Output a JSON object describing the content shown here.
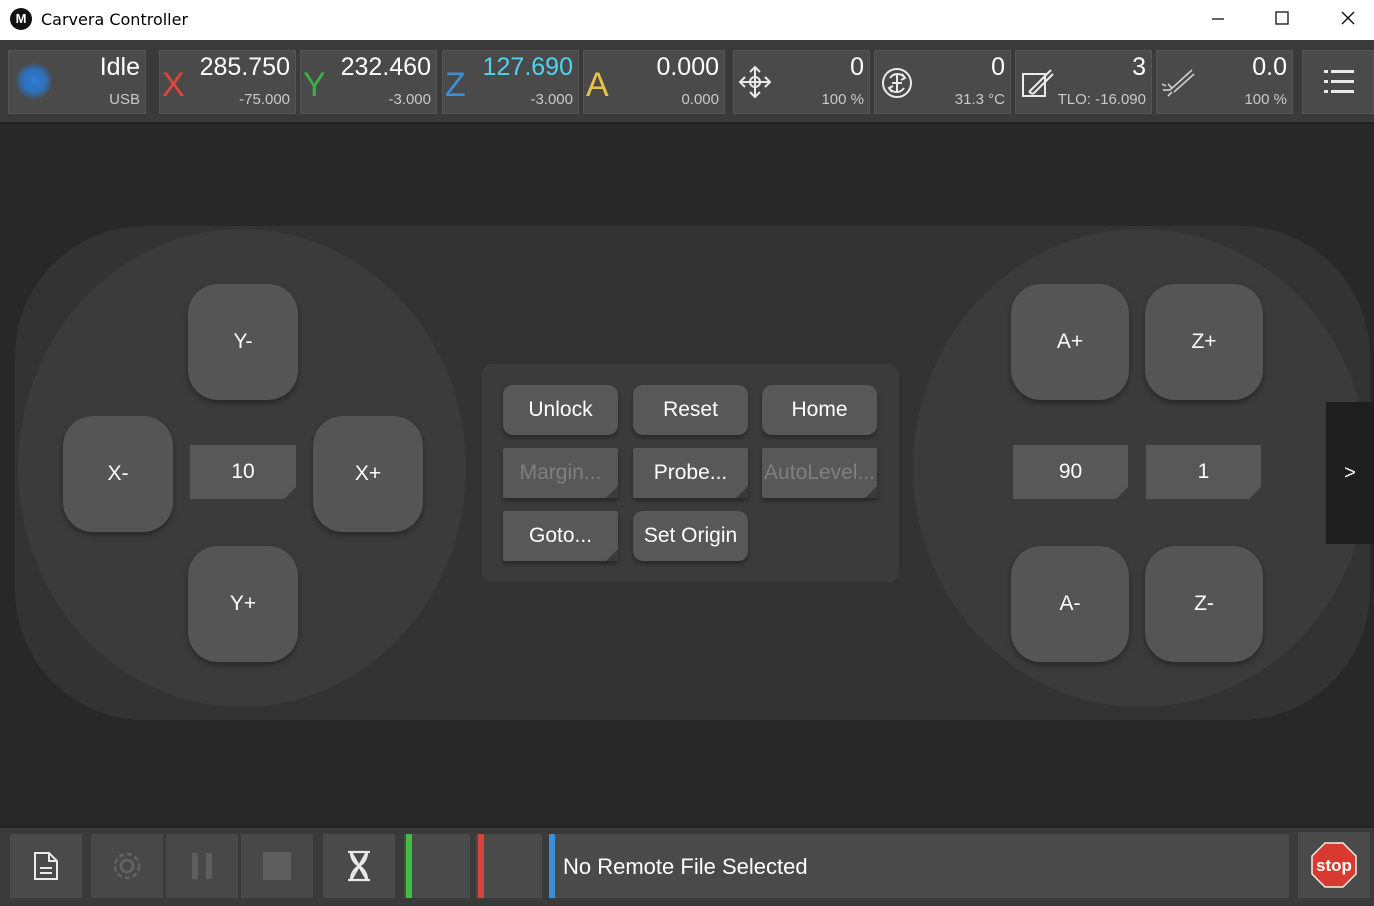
{
  "window": {
    "title": "Carvera Controller",
    "logo_letter": "M"
  },
  "status": {
    "state": "Idle",
    "connection": "USB"
  },
  "axes": {
    "x": {
      "label": "X",
      "value": "285.750",
      "work": "-75.000",
      "color": "#e0443a"
    },
    "y": {
      "label": "Y",
      "value": "232.460",
      "work": "-3.000",
      "color": "#3fae49"
    },
    "z": {
      "label": "Z",
      "value": "127.690",
      "work": "-3.000",
      "color": "#3d8fd8",
      "value_color": "#4fd3f0"
    },
    "a": {
      "label": "A",
      "value": "0.000",
      "work": "0.000",
      "color": "#e6c34a"
    }
  },
  "feed": {
    "value": "0",
    "percent": "100 %",
    "icon": "move-icon"
  },
  "spindle": {
    "value": "0",
    "temp": "31.3 °C",
    "icon": "spindle-icon"
  },
  "tool": {
    "value": "3",
    "tlo": "TLO: -16.090",
    "icon": "tool-icon"
  },
  "laser": {
    "value": "0.0",
    "percent": "100 %",
    "icon": "laser-icon"
  },
  "menu_icon": "menu-icon",
  "jog": {
    "y_minus": "Y-",
    "y_plus": "Y+",
    "x_minus": "X-",
    "x_plus": "X+",
    "xy_step": "10",
    "a_plus": "A+",
    "a_minus": "A-",
    "z_plus": "Z+",
    "z_minus": "Z-",
    "a_step": "90",
    "z_step": "1"
  },
  "actions": {
    "unlock": "Unlock",
    "reset": "Reset",
    "home": "Home",
    "margin": "Margin...",
    "probe": "Probe...",
    "autolevel": "AutoLevel...",
    "goto": "Goto...",
    "set_origin": "Set Origin"
  },
  "side_tab": ">",
  "bottom": {
    "file_status": "No Remote File Selected",
    "stop_label": "stop",
    "stop_color": "#d93a30"
  }
}
